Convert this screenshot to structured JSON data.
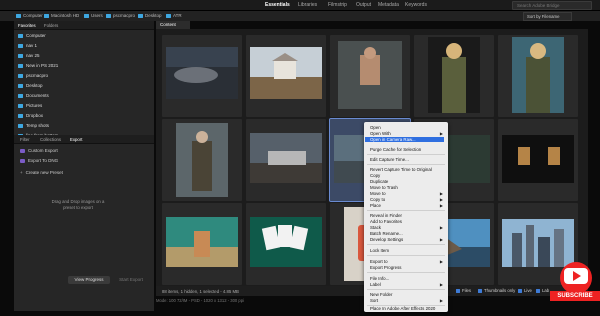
{
  "topbar": {
    "workspaces": [
      "Essentials",
      "Libraries",
      "Filmstrip",
      "Output",
      "Metadata",
      "Keywords"
    ],
    "search_placeholder": "Search Adobe Bridge"
  },
  "path": [
    "Computer",
    "Macintosh HD",
    "Users",
    "pscmacpro",
    "Desktop",
    "ATR"
  ],
  "sort_label": "Sort by Filename",
  "left": {
    "tabs": [
      "Favorites",
      "Folders"
    ],
    "favorites": [
      "Computer",
      "nav 1",
      "nav 25",
      "New in PS 2021",
      "pscmacpro",
      "Desktop",
      "Documents",
      "Pictures",
      "Dropbox",
      "Temp shots",
      "line from bottom"
    ],
    "lower_tabs": [
      "Filter",
      "Collections",
      "Export"
    ],
    "export_items": [
      "Custom Export",
      "Export To DNG",
      "Create new Preset"
    ],
    "drop_text": "Drag and Drop images on a preset to export",
    "view_progress": "View Progress",
    "start_export": "Start Export"
  },
  "content": {
    "tab": "Content",
    "status": "88 items, 1 hidden, 1 selected - 4.85 MB",
    "settings": [
      "Files",
      "Thumbnails only",
      "Live",
      "Lab"
    ],
    "footer": "Mode: 100 72/IM - PSD - 1020 x 1312 - 300 ppi"
  },
  "context_menu": {
    "items": [
      "Open",
      "Open With",
      "Open in Camera Raw...",
      "Purge Cache for Selection",
      "Edit Capture Time...",
      "Revert Capture Time to Original",
      "Copy",
      "Duplicate",
      "Move to Trash",
      "Move to",
      "Copy to",
      "Place",
      "Reveal in Finder",
      "Add to Favorites",
      "Stack",
      "Batch Rename...",
      "Develop Settings",
      "Lock Item",
      "Export to",
      "Export Progress",
      "File Info...",
      "Label",
      "New Folder",
      "Sort",
      "Place In Adobe After Effects 2020"
    ],
    "highlighted": "Open in Camera Raw..."
  },
  "overlay": {
    "subscribe": "SUBSCRIBE"
  },
  "colors": {
    "accent": "#2f6fe0",
    "folder": "#3ea7e0",
    "youtube": "#e22222"
  }
}
